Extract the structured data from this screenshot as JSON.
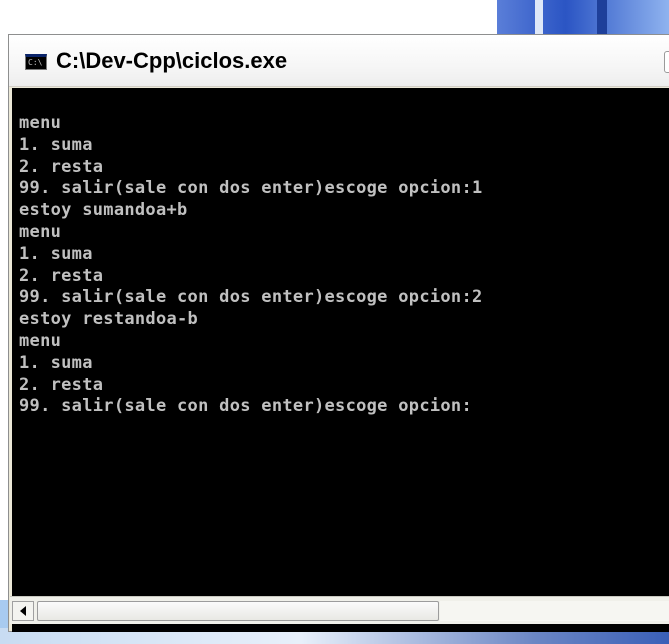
{
  "window": {
    "title": "C:\\Dev-Cpp\\ciclos.exe",
    "icon_label": "C:\\"
  },
  "console": {
    "lines": [
      "menu",
      "1. suma",
      "2. resta",
      "99. salir(sale con dos enter)escoge opcion:1",
      "estoy sumandoa+b",
      "menu",
      "1. suma",
      "2. resta",
      "99. salir(sale con dos enter)escoge opcion:2",
      "estoy restandoa-b",
      "menu",
      "1. suma",
      "2. resta",
      "99. salir(sale con dos enter)escoge opcion:"
    ]
  },
  "icons": {
    "app": "console-icon",
    "scroll_left": "arrow-left-icon"
  },
  "colors": {
    "console_bg": "#000000",
    "console_text": "#c0c0c0",
    "window_frame": "#ece9d8"
  }
}
